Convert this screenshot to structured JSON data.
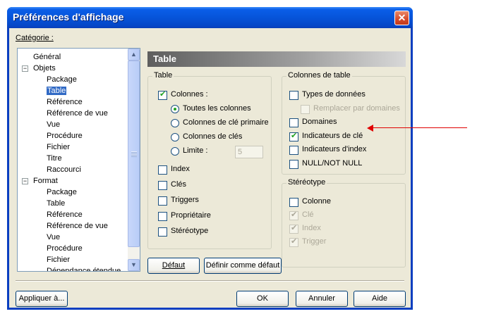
{
  "window": {
    "title": "Préférences d'affichage",
    "close_glyph": "✕"
  },
  "category": {
    "label": "Catégorie :",
    "items": [
      {
        "label": "Général",
        "level": 0
      },
      {
        "label": "Objets",
        "level": 0,
        "expander": "−"
      },
      {
        "label": "Package",
        "level": 1
      },
      {
        "label": "Table",
        "level": 1,
        "selected": true
      },
      {
        "label": "Référence",
        "level": 1
      },
      {
        "label": "Référence de vue",
        "level": 1
      },
      {
        "label": "Vue",
        "level": 1
      },
      {
        "label": "Procédure",
        "level": 1
      },
      {
        "label": "Fichier",
        "level": 1
      },
      {
        "label": "Titre",
        "level": 1
      },
      {
        "label": "Raccourci",
        "level": 1
      },
      {
        "label": "Format",
        "level": 0,
        "expander": "−"
      },
      {
        "label": "Package",
        "level": 1
      },
      {
        "label": "Table",
        "level": 1
      },
      {
        "label": "Référence",
        "level": 1
      },
      {
        "label": "Référence de vue",
        "level": 1
      },
      {
        "label": "Vue",
        "level": 1
      },
      {
        "label": "Procédure",
        "level": 1
      },
      {
        "label": "Fichier",
        "level": 1
      },
      {
        "label": "Dépendance étendue",
        "level": 1
      }
    ]
  },
  "header": {
    "title": "Table"
  },
  "table_group": {
    "title": "Table",
    "columns": {
      "label": "Colonnes :",
      "checked": true
    },
    "radios": [
      {
        "label": "Toutes les colonnes",
        "checked": true
      },
      {
        "label": "Colonnes de clé primaire",
        "checked": false
      },
      {
        "label": "Colonnes de clés",
        "checked": false
      },
      {
        "label": "Limite :",
        "checked": false
      }
    ],
    "limit_value": "5",
    "checkboxes": [
      {
        "label": "Index",
        "checked": false
      },
      {
        "label": "Clés",
        "checked": false
      },
      {
        "label": "Triggers",
        "checked": false
      },
      {
        "label": "Propriétaire",
        "checked": false
      },
      {
        "label": "Stéréotype",
        "checked": false
      }
    ]
  },
  "columns_group": {
    "title": "Colonnes de table",
    "items": [
      {
        "label": "Types de données",
        "checked": false
      },
      {
        "label": "Remplacer par domaines",
        "checked": false,
        "disabled": true
      },
      {
        "label": "Domaines",
        "checked": false
      },
      {
        "label": "Indicateurs de clé",
        "checked": true
      },
      {
        "label": "Indicateurs d'index",
        "checked": false
      },
      {
        "label": "NULL/NOT NULL",
        "checked": false
      }
    ]
  },
  "stereotype_group": {
    "title": "Stéréotype",
    "items": [
      {
        "label": "Colonne",
        "checked": false
      },
      {
        "label": "Clé",
        "checked": true,
        "disabled": true
      },
      {
        "label": "Index",
        "checked": true,
        "disabled": true
      },
      {
        "label": "Trigger",
        "checked": true,
        "disabled": true
      }
    ]
  },
  "buttons": {
    "default": "Défaut",
    "set_default": "Définir comme défaut",
    "apply_to": "Appliquer à...",
    "ok": "OK",
    "cancel": "Annuler",
    "help": "Aide"
  },
  "annotation": {
    "color": "#e00000"
  }
}
